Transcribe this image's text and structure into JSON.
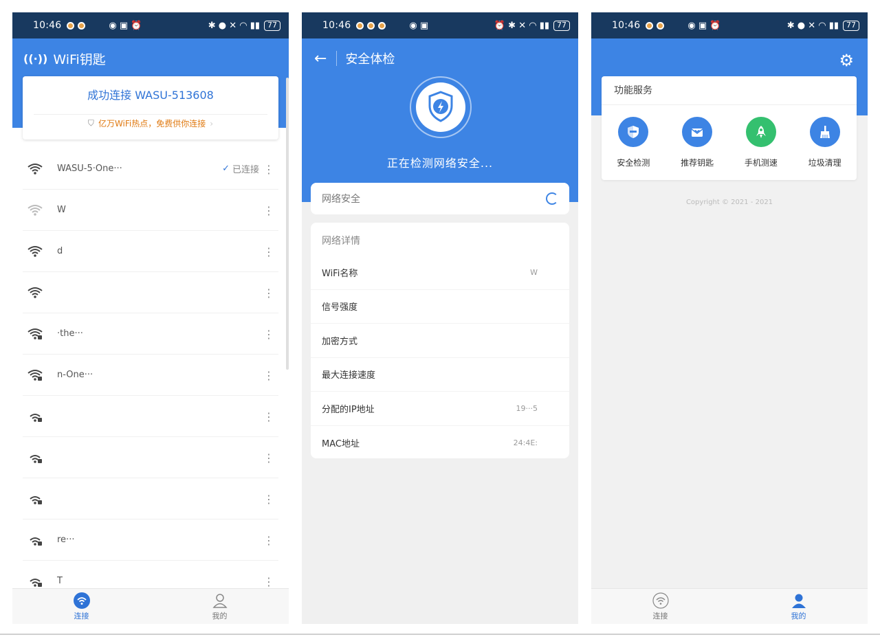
{
  "status": {
    "time": "10:46",
    "battery": "77"
  },
  "panel1": {
    "title": "WiFi钥匙",
    "connected_text": "成功连接 WASU-513608",
    "promo": "亿万WiFi热点，免费供你连接",
    "networks": [
      {
        "name": "WASU-5·One···",
        "status": "已连接",
        "strength": "full"
      },
      {
        "name": "W",
        "status": "",
        "strength": "weak"
      },
      {
        "name": "d",
        "status": "",
        "strength": "full"
      },
      {
        "name": "",
        "status": "",
        "strength": "full"
      },
      {
        "name": "·the···",
        "status": "",
        "strength": "full-lock"
      },
      {
        "name": "n-One···",
        "status": "",
        "strength": "full-lock"
      },
      {
        "name": "",
        "status": "",
        "strength": "mid-lock"
      },
      {
        "name": "",
        "status": "",
        "strength": "mid-lock"
      },
      {
        "name": "",
        "status": "",
        "strength": "mid-lock"
      },
      {
        "name": "re···",
        "status": "",
        "strength": "mid-lock"
      },
      {
        "name": "T",
        "status": "",
        "strength": "mid-lock"
      }
    ],
    "tabs": [
      {
        "label": "连接"
      },
      {
        "label": "我的"
      }
    ]
  },
  "panel2": {
    "title": "安全体检",
    "scan_text": "正在检测网络安全...",
    "security_label": "网络安全",
    "details_header": "网络详情",
    "details": [
      {
        "label": "WiFi名称",
        "value": "W"
      },
      {
        "label": "信号强度",
        "value": ""
      },
      {
        "label": "加密方式",
        "value": ""
      },
      {
        "label": "最大连接速度",
        "value": ""
      },
      {
        "label": "分配的IP地址",
        "value": "19···5"
      },
      {
        "label": "MAC地址",
        "value": "24:4E:"
      }
    ]
  },
  "panel3": {
    "services_header": "功能服务",
    "services": [
      {
        "label": "安全检测",
        "color": "#3d84e4",
        "icon": "shield-icon"
      },
      {
        "label": "推荐钥匙",
        "color": "#3d84e4",
        "icon": "mail-heart-icon"
      },
      {
        "label": "手机测速",
        "color": "#34c06f",
        "icon": "rocket-icon"
      },
      {
        "label": "垃圾清理",
        "color": "#3d84e4",
        "icon": "broom-icon"
      }
    ],
    "copyright": "Copyright © 2021 - 2021",
    "tabs": [
      {
        "label": "连接"
      },
      {
        "label": "我的"
      }
    ]
  }
}
